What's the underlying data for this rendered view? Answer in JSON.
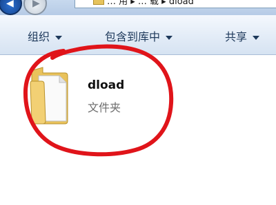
{
  "address_bar": {
    "path_fragment": "…  用 ▸ …  载 ▸ dload"
  },
  "nav": {
    "back_glyph": "◀",
    "forward_glyph": "▶"
  },
  "toolbar": {
    "organize_label": "组织",
    "include_in_library_label": "包含到库中",
    "share_label": "共享"
  },
  "item": {
    "name": "dload",
    "type": "文件夹",
    "icon": "folder-icon"
  },
  "annotation": {
    "circle_color": "#e0141a"
  }
}
